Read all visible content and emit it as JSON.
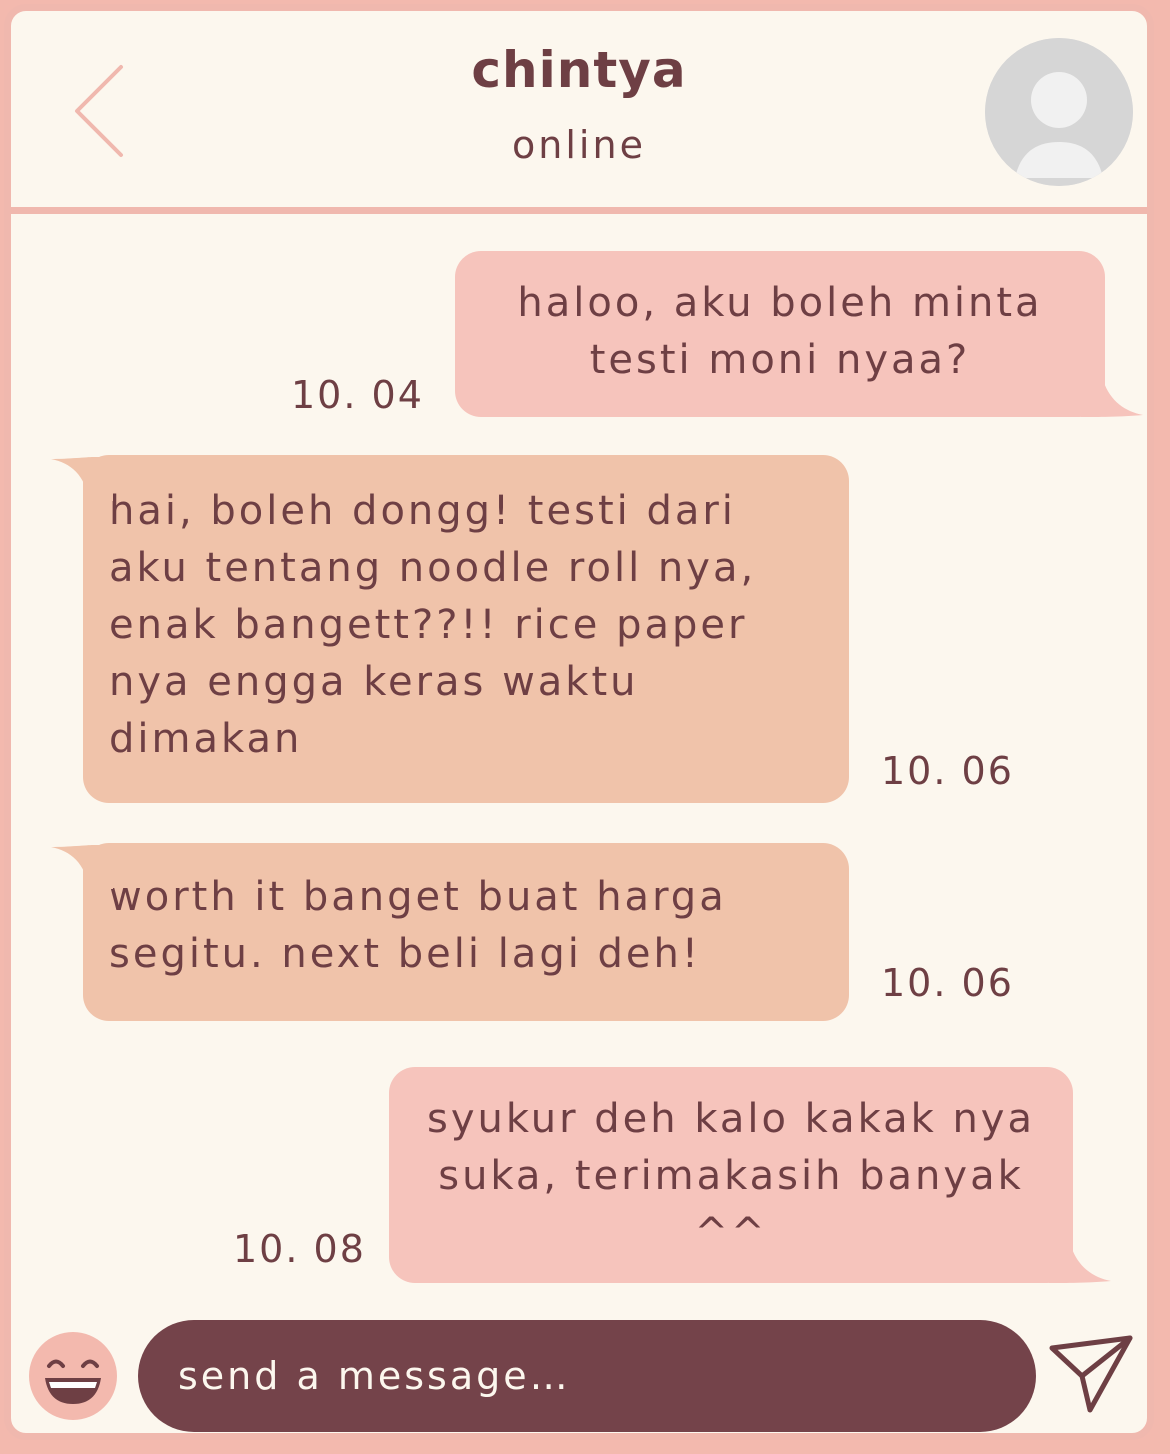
{
  "header": {
    "contact_name": "chintya",
    "status": "online"
  },
  "messages": [
    {
      "direction": "sent",
      "text": "haloo, aku boleh minta testi moni nyaa?",
      "time": "10. 04"
    },
    {
      "direction": "received",
      "text": "hai, boleh dongg! testi dari aku tentang noodle roll nya, enak bangett??!! rice paper nya engga keras waktu dimakan",
      "time": "10. 06"
    },
    {
      "direction": "received",
      "text": "worth it banget buat harga segitu. next beli lagi deh!",
      "time": "10. 06"
    },
    {
      "direction": "sent",
      "text": "syukur deh kalo kakak nya suka, terimakasih banyak ^^",
      "time": "10. 08"
    }
  ],
  "composer": {
    "placeholder": "send a message…"
  },
  "icons": {
    "back": "chevron-left-icon",
    "avatar": "user-avatar-icon",
    "emoji": "smiley-icon",
    "send": "paper-plane-icon"
  },
  "colors": {
    "background": "#fcf7ee",
    "border": "#f0b8ae",
    "sent_bubble": "#f6c4bc",
    "received_bubble": "#f0c3aa",
    "text": "#6e3f44",
    "input_bar": "#74434a"
  }
}
